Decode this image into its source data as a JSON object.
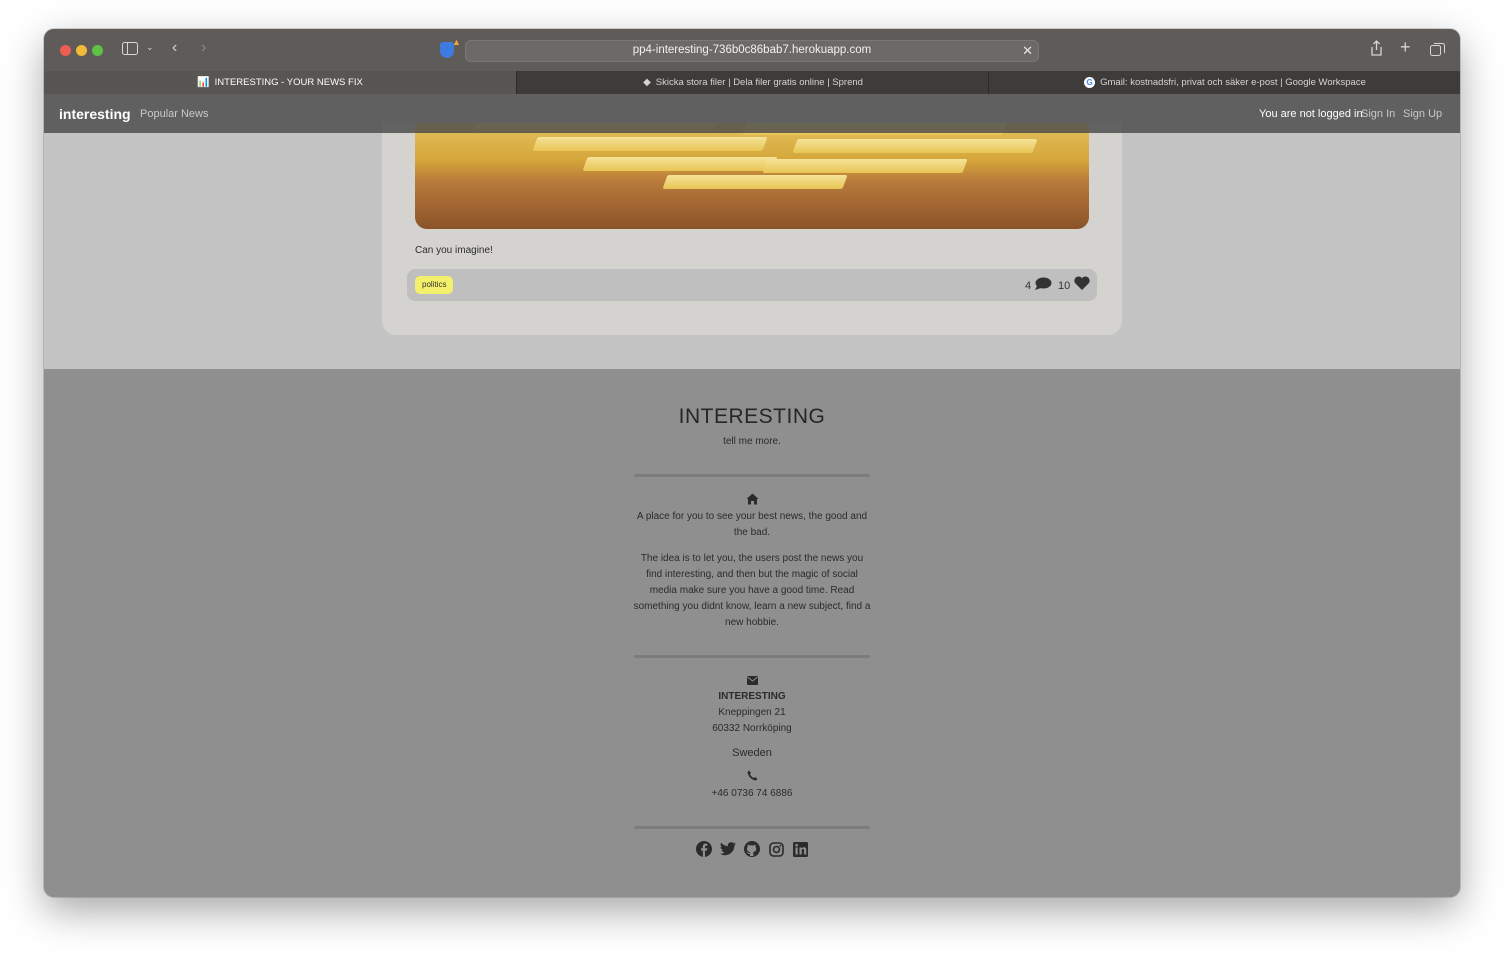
{
  "browser": {
    "url": "pp4-interesting-736b0c86bab7.herokuapp.com",
    "tabs": [
      {
        "label": "INTERESTING - YOUR NEWS FIX",
        "icon": "chart-icon",
        "active": true
      },
      {
        "label": "Skicka stora filer | Dela filer gratis online | Sprend",
        "icon": "sprend-icon",
        "active": false
      },
      {
        "label": "Gmail: kostnadsfri, privat och säker e-post | Google Workspace",
        "icon": "google-icon",
        "active": false
      }
    ]
  },
  "navbar": {
    "brand": "interesting",
    "popular": "Popular News",
    "status": "You are not logged in",
    "sign_in": "Sign In",
    "sign_up": "Sign Up"
  },
  "post": {
    "text": "Can you imagine!",
    "tag": "politics",
    "comments": "4",
    "likes": "10"
  },
  "footer": {
    "title": "INTERESTING",
    "tagline": "tell me more.",
    "about_1": "A place for you to see your best news, the good and the bad.",
    "about_2": "The idea is to let you, the users post the news you find interesting, and then but the magic of social media make sure you have a good time. Read something you didnt know, learn a new subject, find a new hobbie.",
    "contact_name": "INTERESTING",
    "address_1": "Kneppingen 21",
    "address_2": "60332 Norrköping",
    "country": "Sweden",
    "phone": "+46 0736 74 6886"
  },
  "colors": {
    "tag_bg": "#f3f06c",
    "footer_bg": "#8f8f8f",
    "navbar_bg": "#4b4b4b"
  }
}
